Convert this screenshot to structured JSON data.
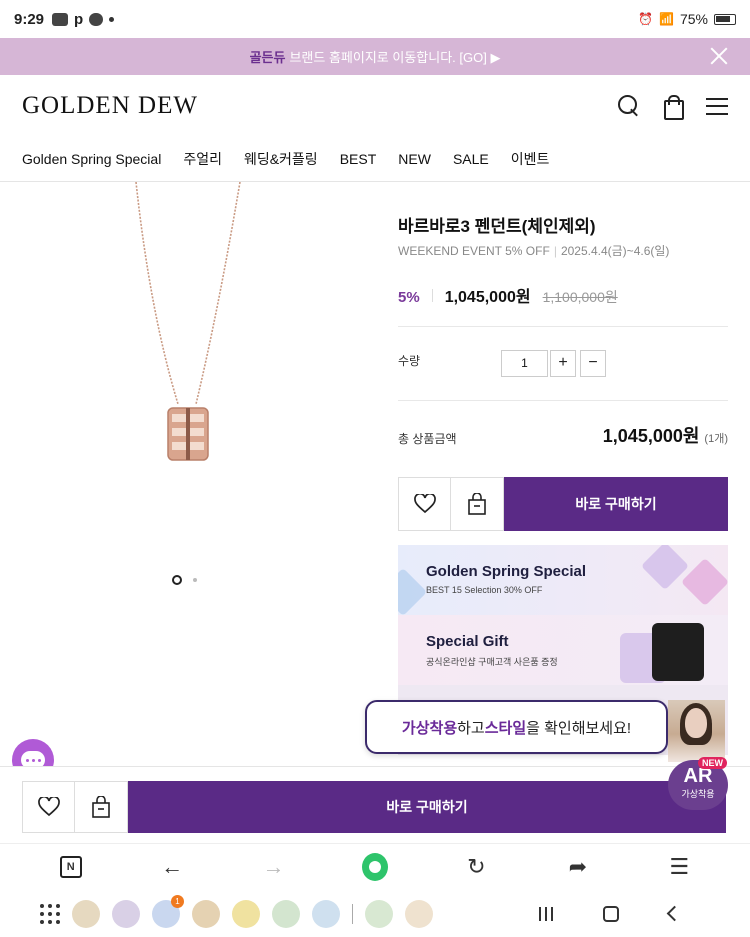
{
  "statusbar": {
    "time": "9:29",
    "letter": "p",
    "battery": "75%"
  },
  "promo": {
    "brand": "골든듀",
    "text": "브랜드 홈페이지로 이동합니다. [GO] ▶"
  },
  "header": {
    "logo": "GOLDEN DEW"
  },
  "nav": [
    "Golden Spring Special",
    "주얼리",
    "웨딩&커플링",
    "BEST",
    "NEW",
    "SALE",
    "이벤트"
  ],
  "product": {
    "title": "바르바로3 펜던트(체인제외)",
    "event": "WEEKEND EVENT 5% OFF",
    "event_date": "2025.4.4(금)~4.6(일)",
    "discount": "5%",
    "price": "1,045,000원",
    "original_price": "1,100,000원",
    "quantity_label": "수량",
    "quantity": "1",
    "plus": "+",
    "minus": "−",
    "total_label": "총 상품금액",
    "total": "1,045,000원",
    "total_count": "(1개)",
    "buy_label": "바로 구매하기",
    "image_dots": {
      "count": 2,
      "active": 0
    }
  },
  "banners": [
    {
      "title": "Golden Spring Special",
      "subtitle": "BEST 15 Selection 30% OFF"
    },
    {
      "title": "Special Gift",
      "subtitle": "공식온라인샵 구매고객 사은품 증정"
    }
  ],
  "ar": {
    "popup_part1": "가상착용",
    "popup_part2": "하고 ",
    "popup_part3": "스타일",
    "popup_part4": "을 확인해보세요!",
    "badge": "AR",
    "badge_sub": "가상착용",
    "new": "NEW"
  },
  "sticky": {
    "buy_label": "바로 구매하기"
  },
  "browser": {
    "n_label": "N"
  },
  "dock": {
    "badge_count": "1"
  },
  "colors": {
    "accent": "#5a2a86",
    "promo_bg": "#d6b6d6",
    "discount": "#7a3a9a",
    "rose_gold": "#d9a58e"
  }
}
